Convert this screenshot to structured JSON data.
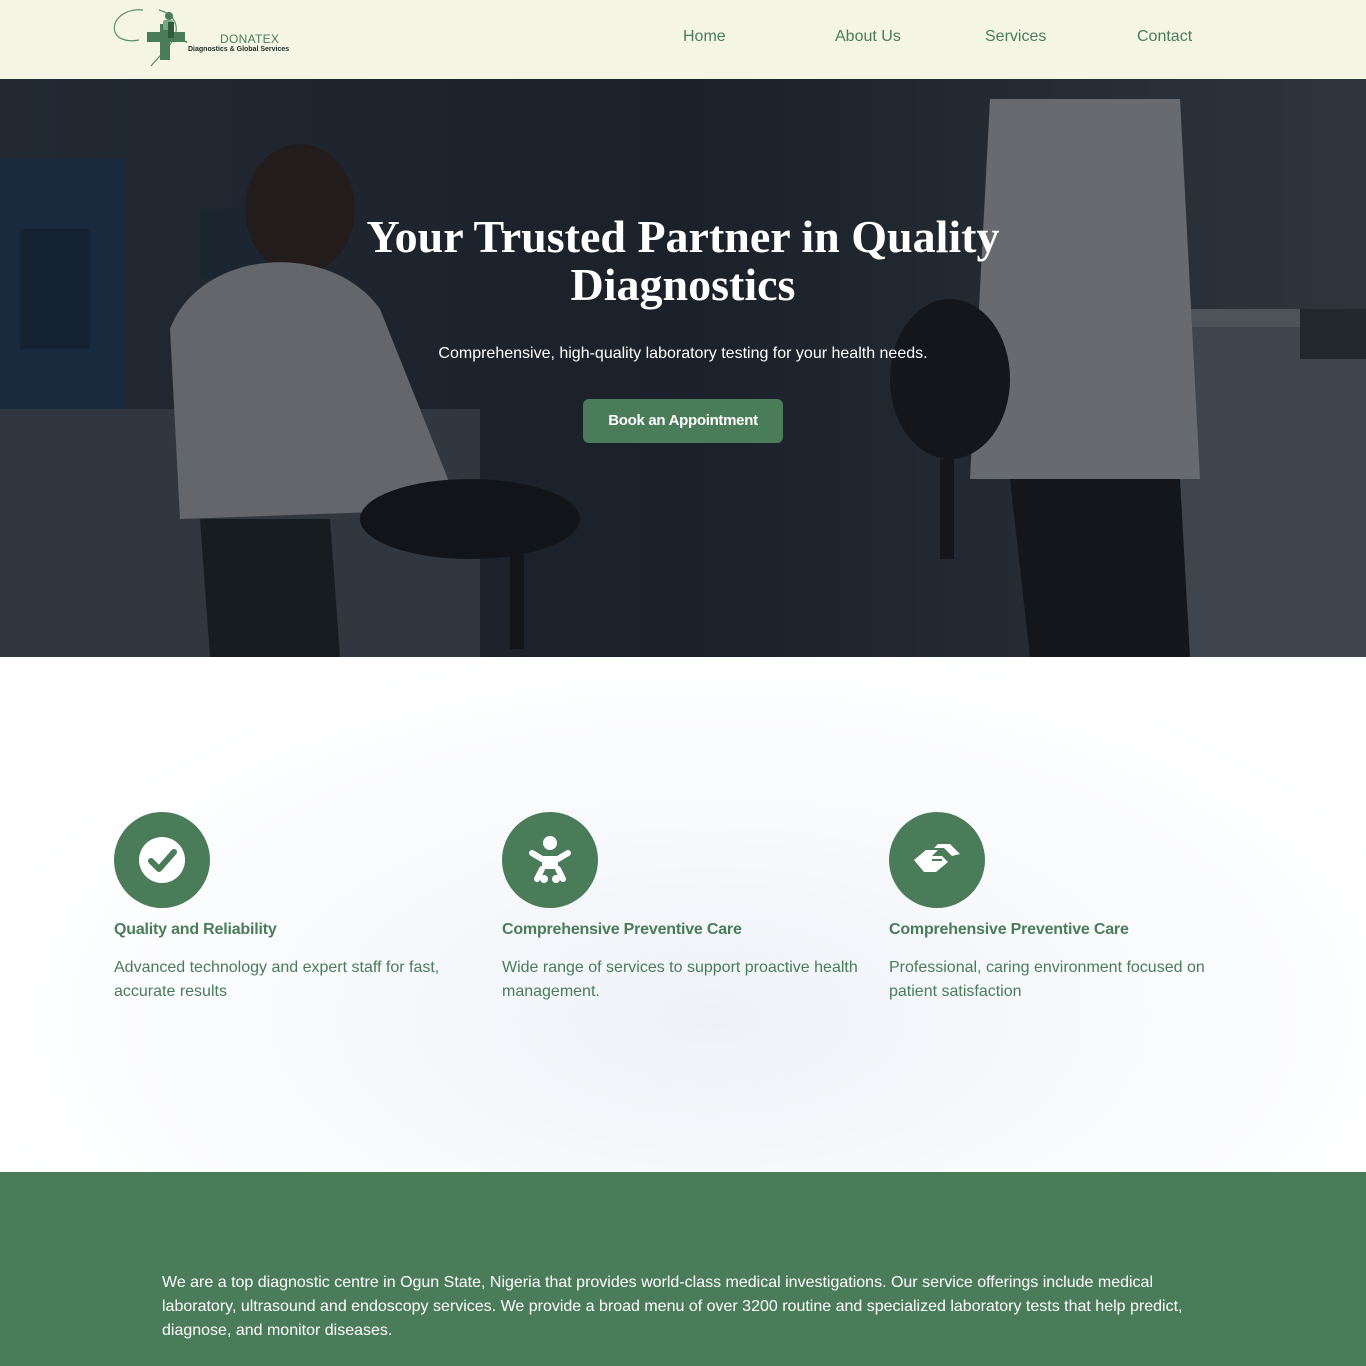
{
  "header": {
    "logo": {
      "title": "DONATEX",
      "subtitle": "Diagnostics & Global Services"
    },
    "nav": [
      {
        "label": "Home"
      },
      {
        "label": "About Us"
      },
      {
        "label": "Services"
      },
      {
        "label": "Contact"
      }
    ]
  },
  "hero": {
    "title": "Your Trusted Partner in Quality Diagnostics",
    "subtitle": "Comprehensive, high-quality laboratory testing for your health needs.",
    "cta_label": "Book an Appointment"
  },
  "features": [
    {
      "icon": "check-circle-icon",
      "title": "Quality and Reliability",
      "text": "Advanced technology and expert staff for fast, accurate results"
    },
    {
      "icon": "baby-icon",
      "title": "Comprehensive Preventive Care",
      "text": "Wide range of services to support proactive health management."
    },
    {
      "icon": "handshake-icon",
      "title": "Comprehensive Preventive Care",
      "text": "Professional, caring environment focused on patient satisfaction"
    }
  ],
  "about": {
    "paragraph": "We are a top diagnostic centre in Ogun State, Nigeria that provides world-class medical investigations. Our service offerings include medical laboratory, ultrasound and endoscopy services. We provide a broad menu of over 3200 routine and specialized laboratory tests that help predict, diagnose, and monitor diseases."
  },
  "colors": {
    "brand_green": "#4a7c59",
    "header_bg": "#f5f5e6",
    "text_white": "#ffffff"
  }
}
